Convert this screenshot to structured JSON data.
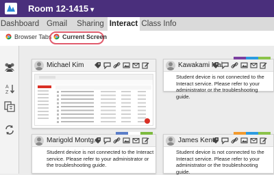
{
  "header": {
    "room": "Room 12-1415",
    "caret": "▾"
  },
  "tabs": [
    {
      "label": "Dashboard"
    },
    {
      "label": "Gmail"
    },
    {
      "label": "Sharing"
    },
    {
      "label": "Interact"
    },
    {
      "label": "Class Info"
    }
  ],
  "subtabs": {
    "browser_tabs": "Browser Tabs",
    "current_screen": "Current Screen"
  },
  "students": [
    {
      "name": "Michael Kim"
    },
    {
      "name": "Kawakami Mai",
      "message": "Student device is not connected to the Interact service. Please refer to your administrator or the troubleshooting guide."
    },
    {
      "name": "Marigold Montg...",
      "message": "Student device is not connected to the Interact service. Please refer to your administrator or the troubleshooting guide."
    },
    {
      "name": "James Kent",
      "message": "Student device is not connected to the Interact service. Please refer to your administrator or the troubleshooting guide."
    }
  ],
  "colors": {
    "topbar": "#4a2f7c",
    "highlight": "#e05a6b",
    "logo": "#2a8ad8"
  }
}
